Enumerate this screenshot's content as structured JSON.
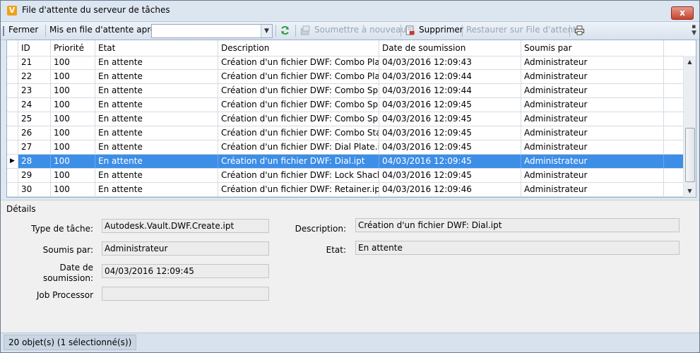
{
  "window": {
    "title": "File d'attente du serveur de tâches",
    "close_label": "x"
  },
  "toolbar": {
    "close_label": "Fermer",
    "queue_after_label": "Mis en file d'attente après:",
    "queue_after_value": "",
    "resubmit_label": "Soumettre à nouveau",
    "delete_label": "Supprimer",
    "restore_label": "Restaurer sur File d'attente"
  },
  "grid": {
    "columns": [
      "ID",
      "Priorité",
      "Etat",
      "Description",
      "Date de soumission",
      "Soumis par"
    ],
    "selected_row": 7,
    "rows": [
      [
        "21",
        "100",
        "En attente",
        "Création d'un fichier DWF: Combo Plate...",
        "04/03/2016 12:09:43",
        "Administrateur"
      ],
      [
        "22",
        "100",
        "En attente",
        "Création d'un fichier DWF: Combo Plate...",
        "04/03/2016 12:09:44",
        "Administrateur"
      ],
      [
        "23",
        "100",
        "En attente",
        "Création d'un fichier DWF: Combo Spac...",
        "04/03/2016 12:09:44",
        "Administrateur"
      ],
      [
        "24",
        "100",
        "En attente",
        "Création d'un fichier DWF: Combo Spac...",
        "04/03/2016 12:09:45",
        "Administrateur"
      ],
      [
        "25",
        "100",
        "En attente",
        "Création d'un fichier DWF: Combo Sprin...",
        "04/03/2016 12:09:45",
        "Administrateur"
      ],
      [
        "26",
        "100",
        "En attente",
        "Création d'un fichier DWF: Combo Stan...",
        "04/03/2016 12:09:45",
        "Administrateur"
      ],
      [
        "27",
        "100",
        "En attente",
        "Création d'un fichier DWF: Dial Plate.ipt",
        "04/03/2016 12:09:45",
        "Administrateur"
      ],
      [
        "28",
        "100",
        "En attente",
        "Création d'un fichier DWF: Dial.ipt",
        "04/03/2016 12:09:45",
        "Administrateur"
      ],
      [
        "29",
        "100",
        "En attente",
        "Création d'un fichier DWF: Lock Shackle...",
        "04/03/2016 12:09:45",
        "Administrateur"
      ],
      [
        "30",
        "100",
        "En attente",
        "Création d'un fichier DWF: Retainer.ipt",
        "04/03/2016 12:09:46",
        "Administrateur"
      ]
    ]
  },
  "details": {
    "title": "Détails",
    "job_type_label": "Type de tâche:",
    "job_type_value": "Autodesk.Vault.DWF.Create.ipt",
    "submitted_by_label": "Soumis par:",
    "submitted_by_value": "Administrateur",
    "submit_date_label_line1": "Date de",
    "submit_date_label_line2": "soumission:",
    "submit_date_value": "04/03/2016 12:09:45",
    "job_processor_label": "Job Processor",
    "job_processor_value": "",
    "description_label": "Description:",
    "description_value": "Création d'un fichier DWF: Dial.ipt",
    "state_label": "Etat:",
    "state_value": "En attente"
  },
  "status": {
    "text": "20 objet(s) (1 sélectionné(s))"
  },
  "colors": {
    "selection": "#3d8ee7",
    "refresh_icon": "#2e9a3a",
    "delete_icon": "#c43b2a"
  }
}
